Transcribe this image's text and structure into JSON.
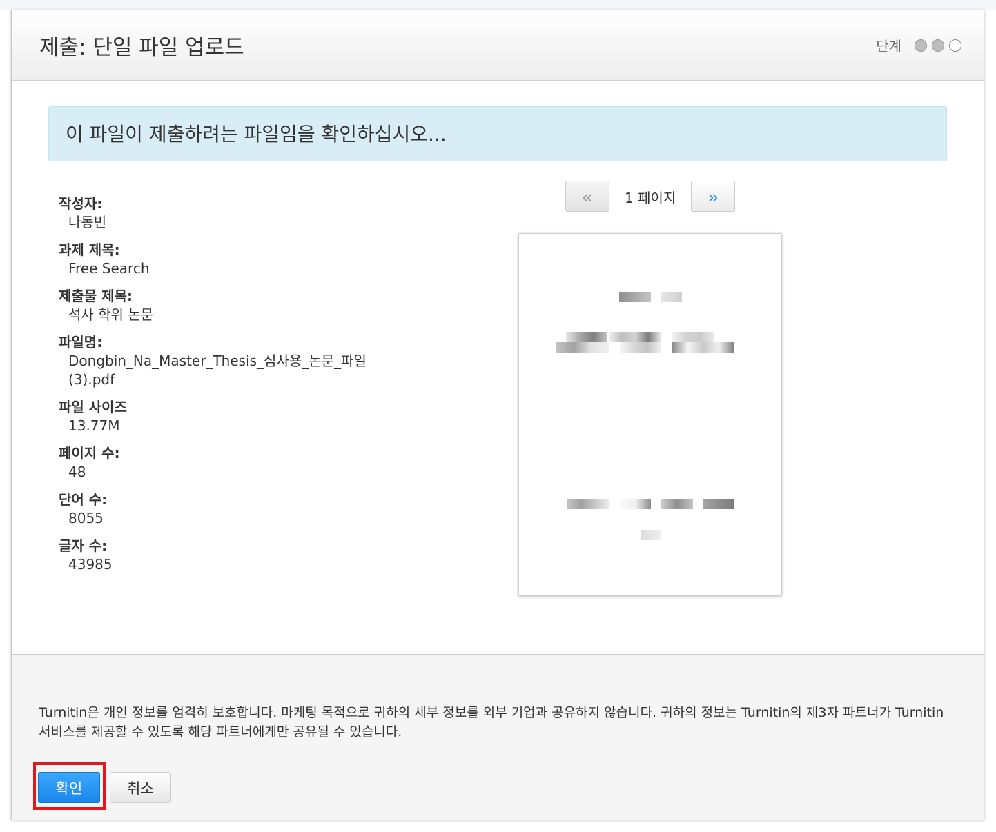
{
  "header": {
    "title": "제출: 단일 파일 업로드",
    "steps_label": "단계",
    "steps": [
      {
        "state": "complete"
      },
      {
        "state": "current"
      },
      {
        "state": "pending"
      }
    ]
  },
  "alert": {
    "message": "이 파일이 제출하려는 파일임을 확인하십시오..."
  },
  "details": [
    {
      "label": "작성자:",
      "value": "나동빈"
    },
    {
      "label": "과제 제목:",
      "value": "Free Search"
    },
    {
      "label": "제출물 제목:",
      "value": "석사 학위 논문"
    },
    {
      "label": "파일명:",
      "value": "Dongbin_Na_Master_Thesis_심사용_논문_파일 (3).pdf"
    },
    {
      "label": "파일 사이즈",
      "value": "13.77M"
    },
    {
      "label": "페이지 수:",
      "value": "48"
    },
    {
      "label": "단어 수:",
      "value": "8055"
    },
    {
      "label": "글자 수:",
      "value": "43985"
    }
  ],
  "pager": {
    "prev_label": "«",
    "next_label": "»",
    "page_label": "1 페이지"
  },
  "footer": {
    "privacy_text": "Turnitin은 개인 정보를 엄격히 보호합니다. 마케팅 목적으로 귀하의 세부 정보를 외부 기업과 공유하지 않습니다. 귀하의 정보는 Turnitin의 제3자 파트너가 Turnitin 서비스를 제공할 수 있도록 해당 파트너에게만 공유될 수 있습니다.",
    "confirm_label": "확인",
    "cancel_label": "취소"
  },
  "colors": {
    "accent": "#1a86ea",
    "alert_bg": "#d9edf7",
    "highlight": "#e0191f"
  }
}
